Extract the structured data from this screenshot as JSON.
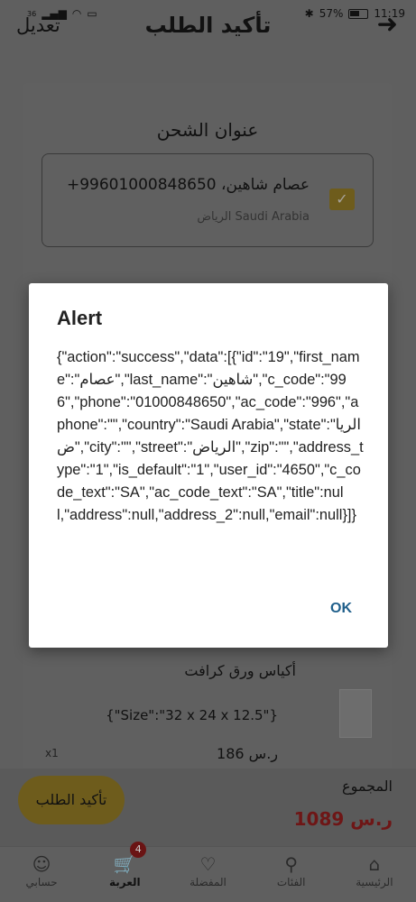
{
  "status_bar": {
    "signal": "36",
    "battery": "57%",
    "time": "11:19"
  },
  "header": {
    "title": "تأكيد الطلب",
    "edit_label": "تعديل",
    "back_icon": "arrow-right-icon"
  },
  "shipping": {
    "title": "عنوان الشحن",
    "name_phone": "عصام شاهين، 99601000848650+",
    "city_country": "Saudi Arabia  الرياض",
    "selected": true
  },
  "product": {
    "name": "أكياس ورق كرافت",
    "size": "{\"Size\":\"32 x 24 x 12.5\"}",
    "price": "186 ر.س",
    "qty": "x1"
  },
  "summary": {
    "total_label": "المجموع",
    "total_value": "1089 ر.س",
    "confirm_label": "تأكيد الطلب"
  },
  "nav": [
    {
      "label": "الرئيسية",
      "icon": "home-icon"
    },
    {
      "label": "الفئات",
      "icon": "search-icon"
    },
    {
      "label": "المفضلة",
      "icon": "heart-icon"
    },
    {
      "label": "العربة",
      "icon": "cart-icon",
      "badge": "4",
      "active": true
    },
    {
      "label": "حسابي",
      "icon": "user-icon"
    }
  ],
  "dialog": {
    "title": "Alert",
    "message": "{\"action\":\"success\",\"data\":[{\"id\":\"19\",\"first_name\":\"عصام\",\"last_name\":\"شاهين\",\"c_code\":\"996\",\"phone\":\"01000848650\",\"ac_code\":\"996\",\"aphone\":\"\",\"country\":\"Saudi Arabia\",\"state\":\"الرياض\",\"city\":\"\",\"street\":\"الرياض\",\"zip\":\"\",\"address_type\":\"1\",\"is_default\":\"1\",\"user_id\":\"4650\",\"c_code_text\":\"SA\",\"ac_code_text\":\"SA\",\"title\":null,\"address\":null,\"address_2\":null,\"email\":null}]}",
    "ok_label": "OK"
  },
  "colors": {
    "accent": "#f0c419",
    "price": "#b71c1c",
    "dialog_button": "#1e88c7"
  }
}
